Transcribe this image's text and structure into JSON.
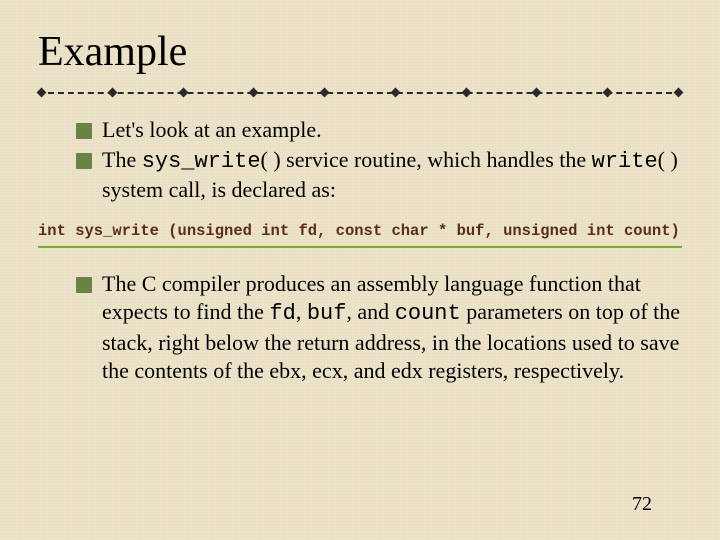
{
  "title": "Example",
  "bullets_top": {
    "item1": "Let's look at an example.",
    "item2": {
      "p1": "The ",
      "code1": "sys_write",
      "p2": "( ) service routine, which handles the ",
      "code2": "write",
      "p3": "( ) system call, is declared as:"
    }
  },
  "code_line": "int sys_write (unsigned int fd, const char * buf, unsigned int count)",
  "bullets_bottom": {
    "item1": {
      "p1": "The C compiler produces an assembly language function that expects to find the ",
      "c1": "fd",
      "p2": ", ",
      "c2": "buf",
      "p3": ", and ",
      "c3": "count",
      "p4": " parameters on top of the stack, right below the return address, in the locations used to save the contents of the ",
      "r1": "ebx",
      "p5": ", ",
      "r2": "ecx",
      "p6": ", and ",
      "r3": "edx",
      "p7": " registers, respectively."
    }
  },
  "page_number": "72"
}
